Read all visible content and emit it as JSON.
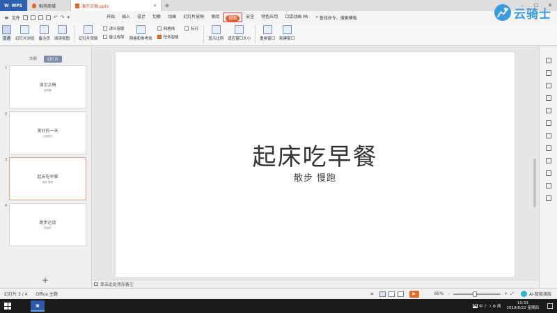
{
  "titlebar": {
    "app_tab": "WPS",
    "store_tab": "稻壳商城",
    "doc_tab": "演示文稿.pptx"
  },
  "menu": {
    "file": "文件",
    "items": [
      "开始",
      "插入",
      "设计",
      "切换",
      "动画",
      "幻灯片放映",
      "审阅",
      "视图",
      "安全",
      "特色应用",
      "口袋动画 PA"
    ],
    "active_index": 7,
    "search": "查找命令、搜索模板"
  },
  "brand": {
    "text": "云骑士"
  },
  "ribbon": {
    "normal": "普通",
    "sorter": "幻灯片浏览",
    "notes_page": "备注页",
    "reading": "阅读视图",
    "master": "幻灯片母版",
    "handout_master": "讲义母版",
    "notes_master": "备注母版",
    "grid_guides": "网格和参考线",
    "gridlines": "网格线",
    "ruler": "标尺",
    "task_pane": "任务窗格",
    "zoom": "显示比例",
    "fit_window": "适应窗口大小",
    "arrange": "重排窗口",
    "new_window": "新建窗口"
  },
  "left_panel": {
    "tab_outline": "大纲",
    "tab_slides": "幻灯片",
    "slides": [
      {
        "num": "1",
        "title": "演示文稿",
        "sub": "副标题"
      },
      {
        "num": "2",
        "title": "美好的一天",
        "sub": "心情很好"
      },
      {
        "num": "3",
        "title": "起床吃早餐",
        "sub": "散步 慢跑"
      },
      {
        "num": "4",
        "title": "跑步运动",
        "sub": "听音乐"
      }
    ],
    "active_index": 2,
    "add_label": "+"
  },
  "slide": {
    "title": "起床吃早餐",
    "subtitle": "散步 慢跑"
  },
  "notes": {
    "placeholder": "单击此处添加备注"
  },
  "status": {
    "slide_info": "幻灯片 3 / 4",
    "theme": "Office 主题",
    "zoom": "85%",
    "zoom_level": 0.45,
    "ai": "AI-智能排版"
  },
  "taskbar": {
    "tray": "中 ♪ ☽ ⚙ 简",
    "time": "10:33",
    "date": "2019/8/22 星期四"
  }
}
